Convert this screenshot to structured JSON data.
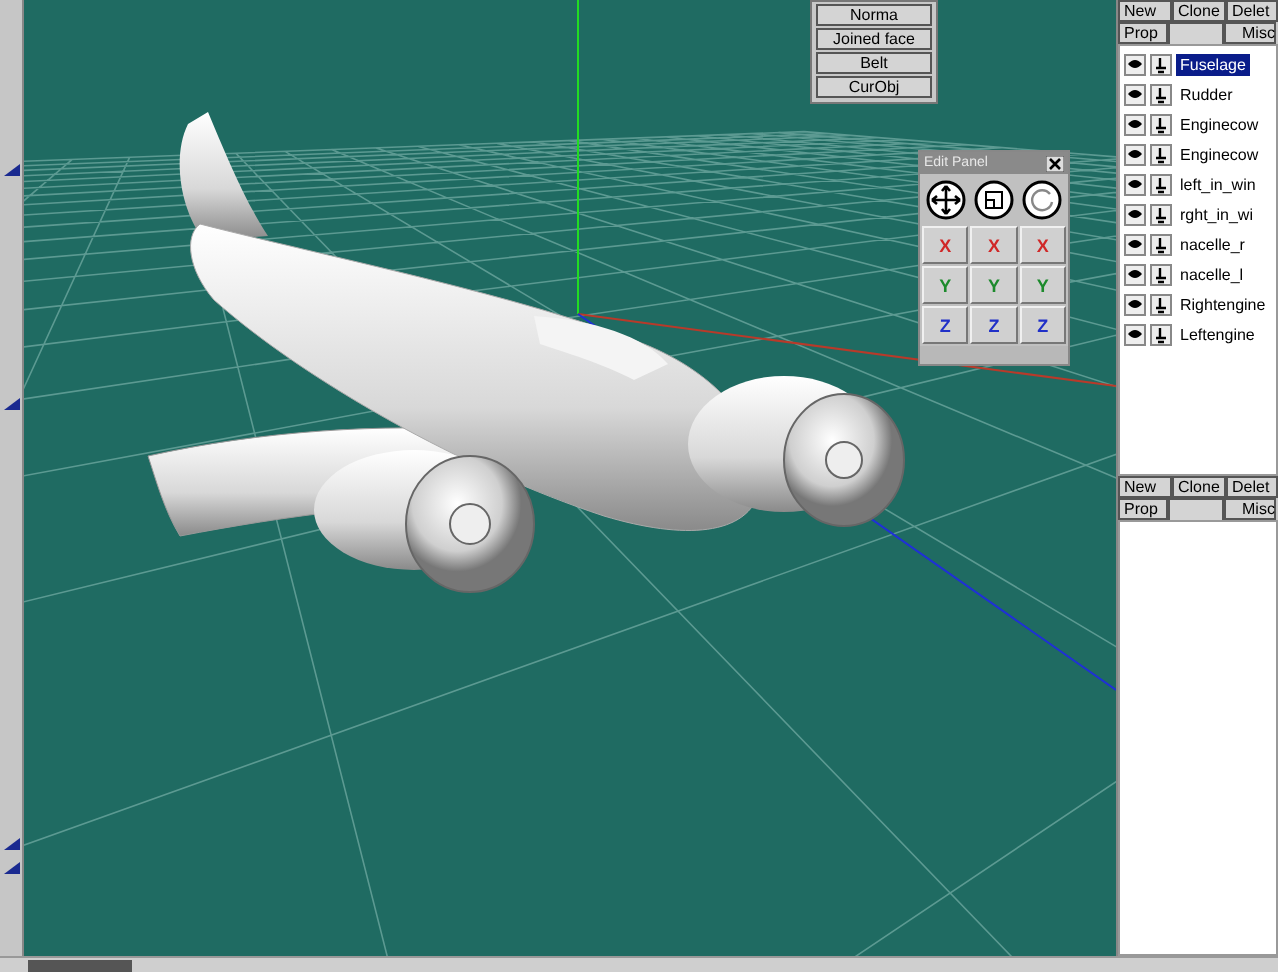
{
  "top_menu": [
    {
      "label": "Norma"
    },
    {
      "label": "Joined face"
    },
    {
      "label": "Belt"
    },
    {
      "label": "CurObj"
    }
  ],
  "edit_panel": {
    "title": "Edit Panel",
    "axis_rows": [
      {
        "color": "#d02828",
        "buttons": [
          "X",
          "X",
          "X"
        ]
      },
      {
        "color": "#1c8a2c",
        "buttons": [
          "Y",
          "Y",
          "Y"
        ]
      },
      {
        "color": "#2030c8",
        "buttons": [
          "Z",
          "Z",
          "Z"
        ]
      }
    ]
  },
  "object_panel": {
    "buttons": [
      "New",
      "Clone",
      "Delet"
    ],
    "tabs": [
      "Prop",
      "Misc"
    ],
    "objects": [
      {
        "name": "Fuselage",
        "selected": true
      },
      {
        "name": "Rudder",
        "selected": false
      },
      {
        "name": "Enginecow",
        "selected": false
      },
      {
        "name": "Enginecow",
        "selected": false
      },
      {
        "name": "left_in_win",
        "selected": false
      },
      {
        "name": "rght_in_wi",
        "selected": false
      },
      {
        "name": "nacelle_r",
        "selected": false
      },
      {
        "name": "nacelle_l",
        "selected": false
      },
      {
        "name": "Rightengine",
        "selected": false
      },
      {
        "name": "Leftengine",
        "selected": false
      }
    ]
  },
  "lower_panel": {
    "buttons": [
      "New",
      "Clone",
      "Delet"
    ],
    "tabs": [
      "Prop",
      "Misc"
    ]
  }
}
